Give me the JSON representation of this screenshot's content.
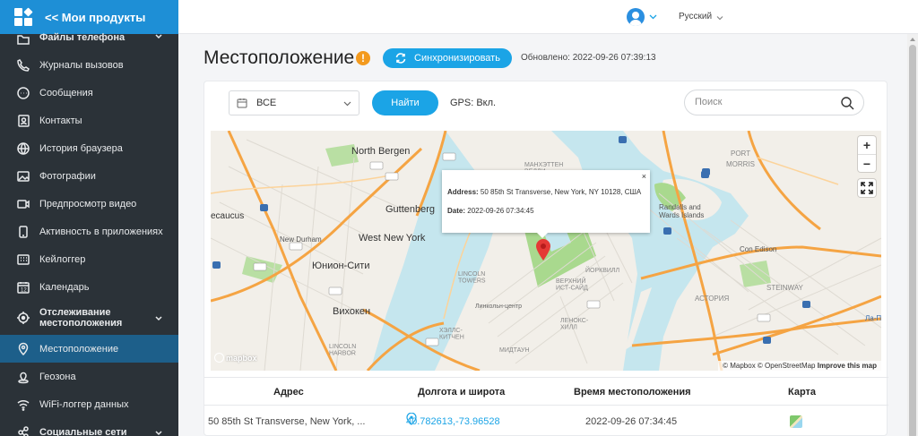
{
  "sidebar": {
    "title": "<< Мои продукты",
    "items": [
      {
        "label": "Файлы телефона",
        "icon": "folder-icon"
      },
      {
        "label": "Журналы вызовов",
        "icon": "phone-icon"
      },
      {
        "label": "Сообщения",
        "icon": "chat-icon"
      },
      {
        "label": "Контакты",
        "icon": "contacts-icon"
      },
      {
        "label": "История браузера",
        "icon": "globe-icon"
      },
      {
        "label": "Фотографии",
        "icon": "image-icon"
      },
      {
        "label": "Предпросмотр видео",
        "icon": "video-icon"
      },
      {
        "label": "Активность в приложениях",
        "icon": "apps-icon"
      },
      {
        "label": "Кейлоггер",
        "icon": "keyboard-icon"
      },
      {
        "label": "Календарь",
        "icon": "calendar-icon"
      },
      {
        "label": "Отслеживание местоположения",
        "icon": "target-icon"
      },
      {
        "label": "Местоположение",
        "icon": "location-pin-icon"
      },
      {
        "label": "Геозона",
        "icon": "geofence-icon"
      },
      {
        "label": "WiFi-логгер данных",
        "icon": "wifi-icon"
      },
      {
        "label": "Социальные сети",
        "icon": "social-icon"
      }
    ]
  },
  "topbar": {
    "language": "Русский"
  },
  "page": {
    "title": "Местоположение",
    "warning_symbol": "!",
    "sync_label": "Синхронизировать",
    "updated": "Обновлено: 2022-09-26 07:39:13"
  },
  "filters": {
    "selected": "ВСЕ",
    "find_label": "Найти",
    "gps_status": "GPS: Вкл.",
    "search_placeholder": "Поиск"
  },
  "map": {
    "popup": {
      "close": "×",
      "address_label": "Address:",
      "address": "50 85th St Transverse, New York, NY 10128, США",
      "date_label": "Date:",
      "date": "2022-09-26 07:34:45"
    },
    "zoom_in": "+",
    "zoom_out": "−",
    "logo": "mapbox",
    "attribution": "© Mapbox © OpenStreetMap",
    "improve": "Improve this map",
    "labels": {
      "north_bergen": "North Bergen",
      "guttenberg": "Guttenberg",
      "west_new_york": "West New York",
      "union_city": "Юнион-Сити",
      "hoboken": "Вихокен",
      "secaucus": "ecaucus",
      "new_durham": "New Durham",
      "upper_west_side": "ВЕРХНИЙ\nИСТ-САЙД",
      "lincoln_towers": "LINCOLN\nTOWERS",
      "lincoln_center": "Линкольн-центр",
      "manhattan": "МАНХЭТТЕН\nВЕЛЛИ",
      "york": "ЙОРКВИЛЛ",
      "lenox_hill": "ЛЕНОКС-\nХИЛЛ",
      "hells_kitchen": "ХЭЛЛС-\nКИТЧЕН",
      "midtown": "МИДТАУН",
      "astoria": "АСТОРИЯ",
      "steinway": "STEINWAY",
      "randalls": "Randalls and\nWards Islands",
      "con_edison": "Con Edison",
      "morris": "MORRIS",
      "port_morris": "PORT",
      "lincoln_harbor": "LINCOLN\nHARBOR",
      "la_re": "Ла-П"
    }
  },
  "table": {
    "headers": [
      "Адрес",
      "Долгота и широта",
      "Время местоположения",
      "Карта"
    ],
    "row": {
      "address": "50 85th St Transverse, New York, ...",
      "coords": "40.782613,-73.96528",
      "time": "2022-09-26 07:34:45"
    }
  },
  "colors": {
    "accent": "#1ba4e6",
    "sidebar_bg": "#2b3238",
    "sidebar_active": "#1d5f8a",
    "header_blue": "#1e8fd6",
    "warning": "#f39a1e",
    "water": "#c5e6ee",
    "park": "#a9d98e",
    "pin": "#e53935"
  }
}
